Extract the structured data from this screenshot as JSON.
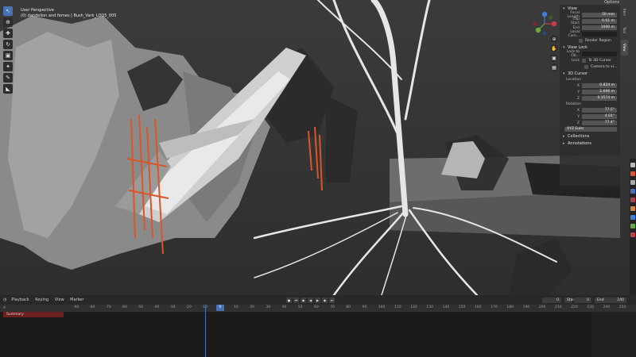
{
  "viewport": {
    "perspective_label": "User Perspective",
    "object_label": "(0) dandelion and fernes | Bush_Vark_LOD5_005"
  },
  "toolbar": {
    "tools": [
      {
        "name": "select-box-tool",
        "glyph": "↖",
        "active": true
      },
      {
        "name": "cursor-tool",
        "glyph": "⊕",
        "active": false
      },
      {
        "name": "move-tool",
        "glyph": "✚",
        "active": false
      },
      {
        "name": "rotate-tool",
        "glyph": "↻",
        "active": false
      },
      {
        "name": "scale-tool",
        "glyph": "▣",
        "active": false
      },
      {
        "name": "transform-tool",
        "glyph": "✦",
        "active": false
      },
      {
        "name": "annotate-tool",
        "glyph": "✎",
        "active": false
      },
      {
        "name": "measure-tool",
        "glyph": "◣",
        "active": false
      }
    ]
  },
  "nav_buttons": [
    {
      "name": "zoom-icon",
      "glyph": "⊕"
    },
    {
      "name": "hand-pan-icon",
      "glyph": "✋"
    },
    {
      "name": "camera-view-icon",
      "glyph": "▣"
    },
    {
      "name": "grid-toggle-icon",
      "glyph": "▦"
    }
  ],
  "options_label": "Options",
  "npanel": {
    "view_section": "View",
    "focal_length_label": "Focal Length",
    "focal_length_value": "50 mm",
    "clip_start_label": "Clip Start",
    "clip_start_value": "0.01 m",
    "clip_end_label": "End",
    "clip_end_value": "1000 m",
    "local_camera_label": "Local Cam...",
    "render_region_label": "Render Region",
    "view_lock_section": "View Lock",
    "lock_to_object_label": "Lock to Ob...",
    "lock_label": "Lock",
    "to_3d_cursor_label": "To 3D Cursor",
    "camera_to_view_label": "Camera to vi...",
    "cursor_section": "3D Cursor",
    "location_label": "Location",
    "loc_x_label": "X",
    "loc_x_value": "0.834 m",
    "loc_y_label": "Y",
    "loc_y_value": "2.696 m",
    "loc_z_label": "Z",
    "loc_z_value": "0.3574 m",
    "rotation_label": "Rotation",
    "rot_x_label": "X",
    "rot_x_value": "77.5°",
    "rot_y_label": "Y",
    "rot_y_value": "4.01°",
    "rot_z_label": "Z",
    "rot_z_value": "77.4°",
    "rotation_mode": "XYZ Euler",
    "collections_section": "Collections",
    "annotations_section": "Annotations",
    "tabs": [
      "Item",
      "Tool",
      "View"
    ]
  },
  "timeline": {
    "menu": [
      "Playback",
      "Keying",
      "View",
      "Marker"
    ],
    "current_frame": "0",
    "start_label": "Start",
    "start_value": "0",
    "end_label": "End",
    "end_value": "240",
    "summary_label": "Summary",
    "ruler_ticks": [
      "-90",
      "-80",
      "-70",
      "-60",
      "-50",
      "-40",
      "-30",
      "-20",
      "-10",
      "0",
      "10",
      "20",
      "30",
      "40",
      "50",
      "60",
      "70",
      "80",
      "90",
      "100",
      "110",
      "120",
      "130",
      "140",
      "150",
      "160",
      "170",
      "180",
      "190",
      "200",
      "210",
      "220",
      "230",
      "240",
      "250",
      "260",
      "270"
    ]
  },
  "colors": {
    "accent": "#4772b3",
    "selection_orange": "#d9552a",
    "summary_red": "#6b1f1f",
    "axis_x": "#d03a47",
    "axis_y": "#6aa83b",
    "axis_z": "#3d7fd6"
  }
}
